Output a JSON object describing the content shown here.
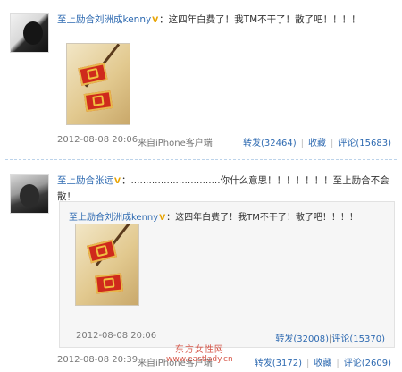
{
  "post1": {
    "user": "至上励合刘洲成kenny",
    "badge": "V",
    "message": "：这四年白费了！我TM不干了！散了吧！！！！",
    "time": "2012-08-08 20:06",
    "source": "来自iPhone客户端",
    "repost": "转发(32464)",
    "favorite": "收藏",
    "comment": "评论(15683)"
  },
  "post2": {
    "user": "至上励合张远",
    "badge": "V",
    "message": "：..............................你什么意思！！！！！！！至上励合不会散！",
    "time": "2012-08-08 20:39",
    "source": "来自iPhone客户端",
    "repost": "转发(3172)",
    "favorite": "收藏",
    "comment": "评论(2609)",
    "quote": {
      "user": "至上励合刘洲成kenny",
      "badge": "V",
      "message": "：这四年白费了！我TM不干了！散了吧！！！！",
      "time": "2012-08-08 20:06",
      "repost": "转发(32008)",
      "comment": "评论(15370)"
    }
  },
  "watermark": {
    "text": "东方女性网",
    "url": "www.eastlady.cn"
  }
}
